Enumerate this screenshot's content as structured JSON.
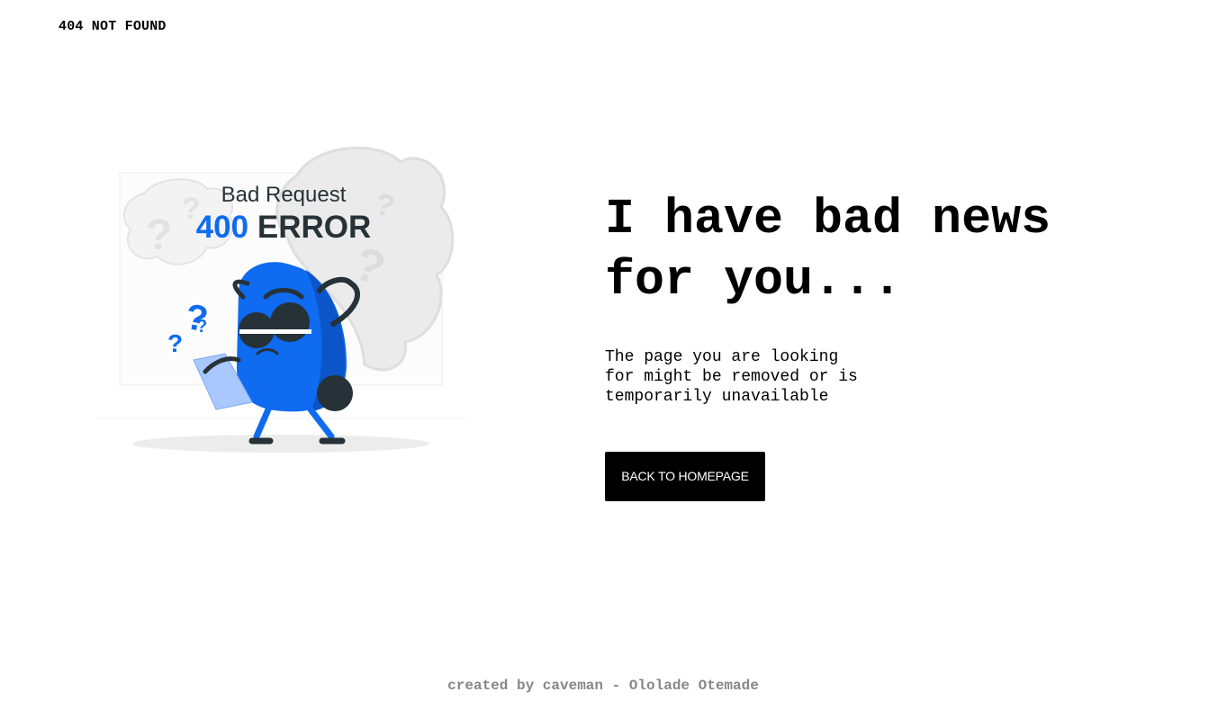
{
  "header": {
    "brand": "404 NOT FOUND"
  },
  "illustration": {
    "caption_small": "Bad Request",
    "caption_code": "400",
    "caption_word": "ERROR",
    "accent_color": "#0f6bf0"
  },
  "main": {
    "headline": "I have bad news for you...",
    "message": "The page you are looking\nfor might be removed or is\ntemporarily unavailable",
    "cta_label": "BACK TO HOMEPAGE"
  },
  "footer": {
    "credit": "created by caveman - Ololade Otemade"
  }
}
